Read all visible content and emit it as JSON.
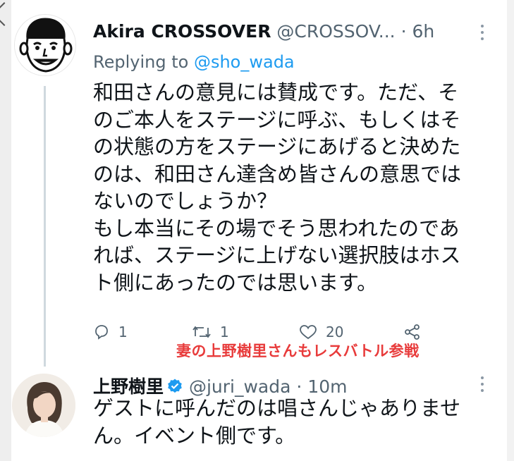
{
  "tweet1": {
    "name": "Akira CROSSOVER",
    "handle": "@CROSSOV...",
    "separator": "·",
    "time": "6h",
    "replying_prefix": "Replying to",
    "replying_handle": "@sho_wada",
    "lines": [
      "和田さんの意見には賛成です。ただ、そ",
      "のご本人をステージに呼ぶ、もしくはそ",
      "の状態の方をステージにあげると決めた",
      "のは、和田さん達含め皆さんの意思では",
      "ないのでしょうか？",
      "もし本当にその場でそう思われたのであ",
      "れば、ステージに上げない選択肢はホス",
      "ト側にあったのでは思います。"
    ],
    "actions": {
      "reply_count": "1",
      "retweet_count": "1",
      "like_count": "20"
    }
  },
  "annotation": "妻の上野樹里さんもレスバトル参戦",
  "tweet2": {
    "name": "上野樹里",
    "handle": "@juri_wada",
    "separator": "·",
    "time": "10m",
    "lines": [
      "ゲストに呼んだのは唱さんじゃありませ",
      "ん。イベント側です。"
    ]
  },
  "colors": {
    "link": "#1d9bf0",
    "secondary_text": "#536471",
    "annotation": "#e83b3b",
    "verified": "#1d9bf0",
    "thread_line": "#cfd9de"
  }
}
